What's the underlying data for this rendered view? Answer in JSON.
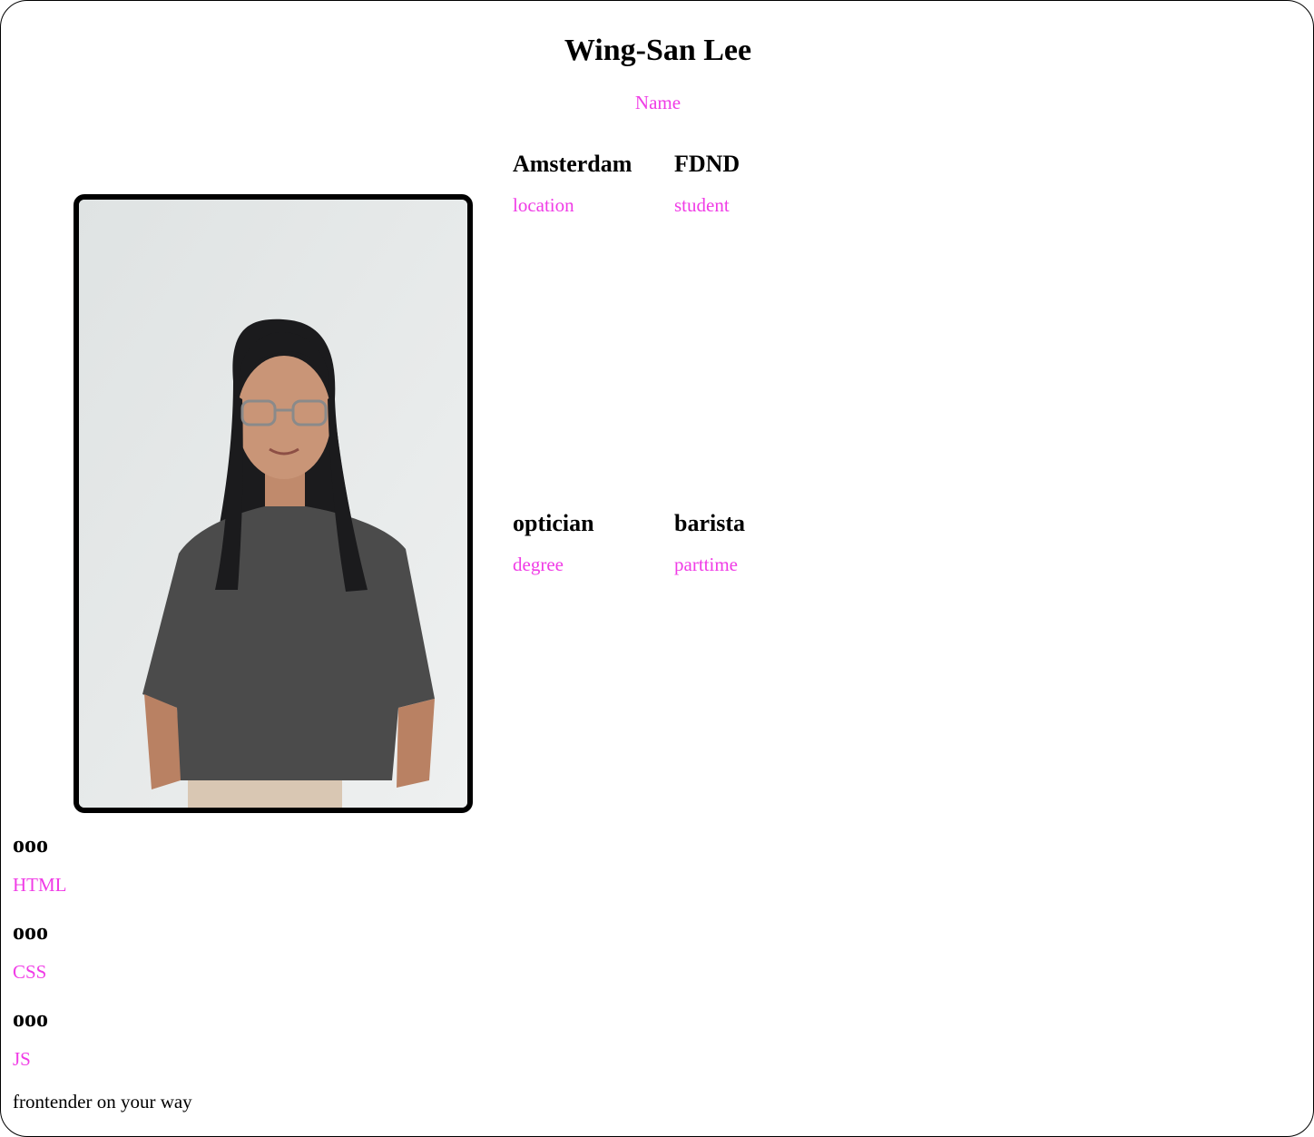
{
  "theme": {
    "accent": "#f03ce6"
  },
  "profile": {
    "name": "Wing-San Lee",
    "name_caption": "Name",
    "photo_icon": "portrait-photo"
  },
  "facts": [
    {
      "value": "Amsterdam",
      "caption": "location"
    },
    {
      "value": "FDND",
      "caption": "student"
    },
    {
      "value": "optician",
      "caption": "degree"
    },
    {
      "value": "barista",
      "caption": "parttime"
    }
  ],
  "skills": [
    {
      "level": "ooo",
      "caption": "HTML"
    },
    {
      "level": "ooo",
      "caption": "CSS"
    },
    {
      "level": "ooo",
      "caption": "JS"
    }
  ],
  "tagline": "frontender on your way"
}
